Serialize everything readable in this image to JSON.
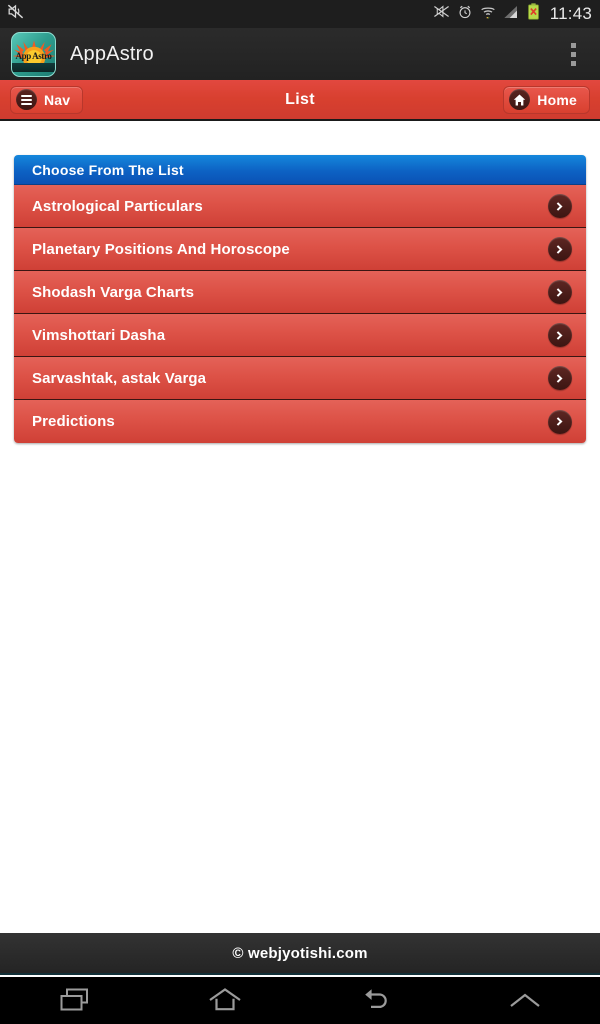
{
  "status_bar": {
    "icons": [
      "mute-icon",
      "alarm-clock-icon",
      "wifi-icon",
      "signal-bars-icon",
      "battery-error-icon"
    ],
    "time": "11:43"
  },
  "app_bar": {
    "icon": "appastro-logo-icon",
    "icon_word": "App Astro",
    "title": "AppAstro",
    "overflow": "overflow-menu-icon"
  },
  "toolbar": {
    "nav_label": "Nav",
    "nav_icon": "hamburger-menu-icon",
    "title": "List",
    "home_label": "Home",
    "home_icon": "house-icon"
  },
  "list": {
    "header": "Choose From The List",
    "chevron_icon": "chevron-right-icon",
    "items": [
      {
        "label": "Astrological Particulars"
      },
      {
        "label": "Planetary Positions And Horoscope"
      },
      {
        "label": "Shodash Varga Charts"
      },
      {
        "label": "Vimshottari Dasha"
      },
      {
        "label": "Sarvashtak, astak Varga"
      },
      {
        "label": "Predictions"
      }
    ]
  },
  "footer": {
    "text": "© webjyotishi.com"
  },
  "nav_bar": {
    "buttons": [
      "recents-icon",
      "home-icon",
      "back-icon",
      "chevron-up-icon"
    ]
  },
  "colors": {
    "accent_red": "#d8402f",
    "header_blue": "#0d62c4",
    "row_red": "#dd5247",
    "dark": "#1e1e1e"
  }
}
